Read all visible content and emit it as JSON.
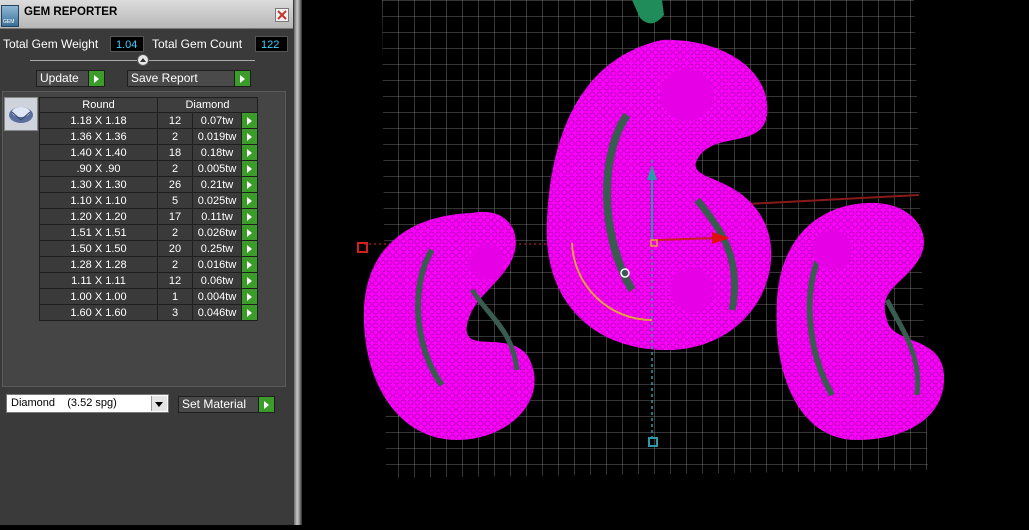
{
  "panel": {
    "title": "GEM REPORTER",
    "total_weight_label": "Total Gem Weight",
    "total_weight_value": "1.04",
    "total_count_label": "Total Gem Count",
    "total_count_value": "122",
    "update_label": "Update",
    "save_report_label": "Save Report"
  },
  "gem_table": {
    "shape_header": "Round",
    "material_header": "Diamond",
    "rows": [
      {
        "size": "1.18 X 1.18",
        "count": "12",
        "weight": "0.07tw"
      },
      {
        "size": "1.36 X 1.36",
        "count": "2",
        "weight": "0.019tw"
      },
      {
        "size": "1.40 X 1.40",
        "count": "18",
        "weight": "0.18tw"
      },
      {
        "size": ".90 X .90",
        "count": "2",
        "weight": "0.005tw"
      },
      {
        "size": "1.30 X 1.30",
        "count": "26",
        "weight": "0.21tw"
      },
      {
        "size": "1.10 X 1.10",
        "count": "5",
        "weight": "0.025tw"
      },
      {
        "size": "1.20 X 1.20",
        "count": "17",
        "weight": "0.11tw"
      },
      {
        "size": "1.51 X 1.51",
        "count": "2",
        "weight": "0.026tw"
      },
      {
        "size": "1.50 X 1.50",
        "count": "20",
        "weight": "0.25tw"
      },
      {
        "size": "1.28 X 1.28",
        "count": "2",
        "weight": "0.016tw"
      },
      {
        "size": "1.11 X 1.11",
        "count": "12",
        "weight": "0.06tw"
      },
      {
        "size": "1.00 X 1.00",
        "count": "1",
        "weight": "0.004tw"
      },
      {
        "size": "1.60 X 1.60",
        "count": "3",
        "weight": "0.046tw"
      }
    ]
  },
  "material": {
    "selected": "Diamond    (3.52 spg)",
    "set_label": "Set Material"
  },
  "colors": {
    "model": "#ff00ff",
    "grid": "#8c8c8c",
    "value_text": "#3fd0ff",
    "play_button": "#3c9c2a"
  },
  "icons": [
    "gem-reporter-app-icon",
    "close-icon",
    "collapse-icon",
    "round-gem-icon",
    "play-icon",
    "dropdown-arrow-icon"
  ]
}
